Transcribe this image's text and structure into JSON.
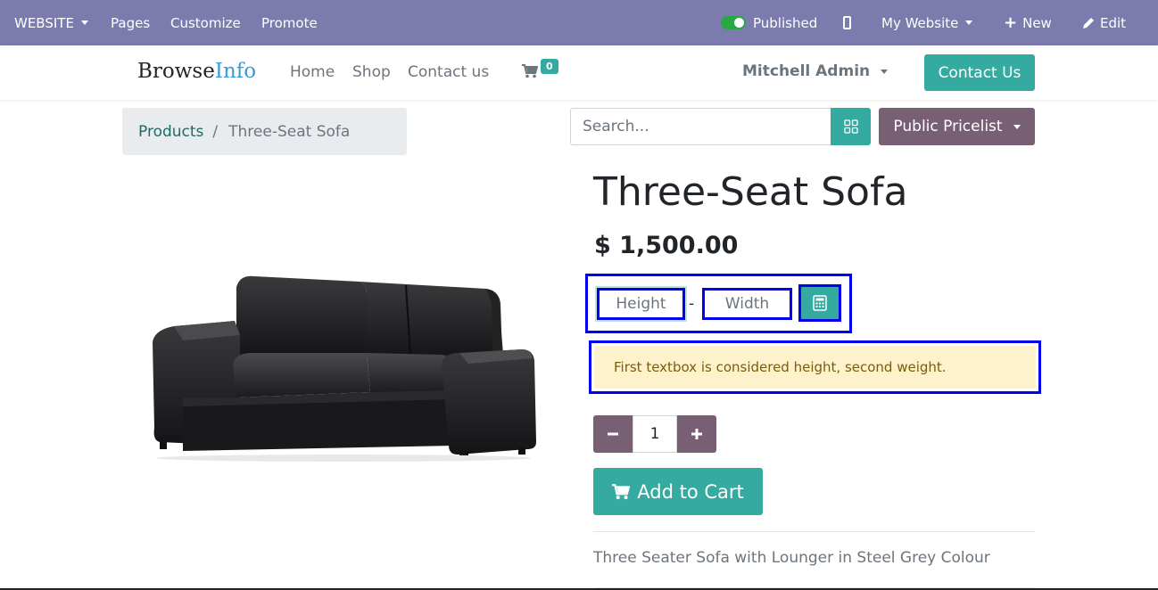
{
  "admin_bar": {
    "website_menu": "WEBSITE",
    "pages": "Pages",
    "customize": "Customize",
    "promote": "Promote",
    "published": "Published",
    "my_website": "My Website",
    "new": "New",
    "edit": "Edit"
  },
  "header": {
    "logo_part1": "Browse",
    "logo_part2": "Info",
    "nav": [
      "Home",
      "Shop",
      "Contact us"
    ],
    "cart_count": "0",
    "user": "Mitchell Admin",
    "contact_button": "Contact Us"
  },
  "breadcrumb": {
    "parent": "Products",
    "separator": "/",
    "current": "Three-Seat Sofa"
  },
  "search": {
    "placeholder": "Search..."
  },
  "pricelist": "Public Pricelist",
  "product": {
    "title": "Three-Seat Sofa",
    "price": "$ 1,500.00",
    "height_placeholder": "Height",
    "width_placeholder": "Width",
    "dash": "-",
    "hint": "First textbox is considered height, second weight.",
    "quantity": "1",
    "add_to_cart": "Add to Cart",
    "description": "Three Seater Sofa with Lounger in Steel Grey Colour"
  },
  "colors": {
    "admin_bar": "#7c7bad",
    "primary": "#35aaa0",
    "secondary": "#785f73",
    "highlight_border": "#0000ee"
  }
}
